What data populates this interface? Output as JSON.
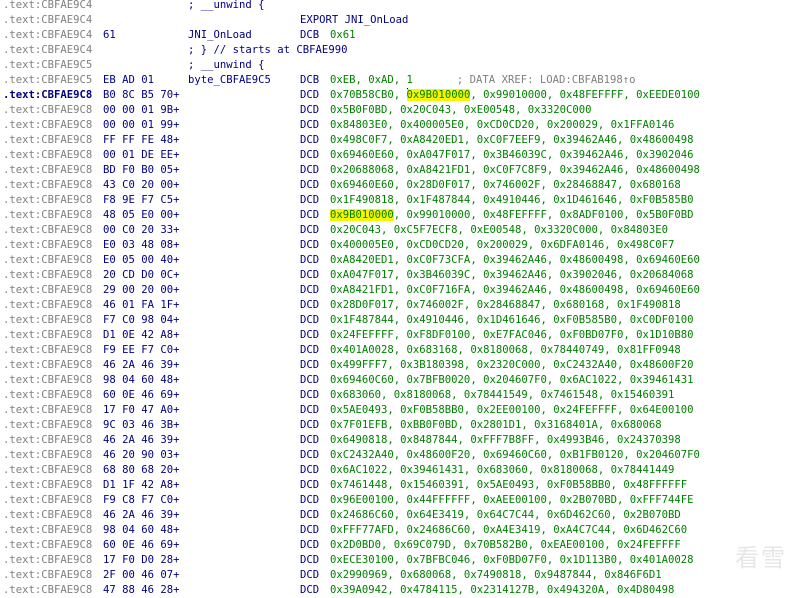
{
  "header_lines": [
    {
      "addr": ".text:CBFAE9C4",
      "bytes": "",
      "text": "; __unwind {"
    },
    {
      "addr": ".text:CBFAE9C4",
      "bytes": "",
      "export": "EXPORT JNI_OnLoad"
    },
    {
      "addr": ".text:CBFAE9C4",
      "bytes": "61",
      "label": "JNI_OnLoad",
      "mnem": "DCB",
      "ops": "0x61"
    },
    {
      "addr": ".text:CBFAE9C4",
      "bytes": "",
      "text": "; } // starts at CBFAE990"
    },
    {
      "addr": ".text:CBFAE9C5",
      "bytes": "",
      "text": "; __unwind {"
    }
  ],
  "byte_line": {
    "addr": ".text:CBFAE9C5",
    "bytes": "EB AD 01",
    "label": "byte_CBFAE9C5",
    "mnem": "DCB",
    "ops": "0xEB, 0xAD, 1",
    "xref": "; DATA XREF: LOAD:CBFAB198",
    "xref_icon": "↑o"
  },
  "cursor_line": {
    "addr": ".text:CBFAE9C8",
    "bytes": "B0 8C B5 70+",
    "mnem": "DCD",
    "ops_pre": "0x70B58CB0, ",
    "ops_hl": "0x9B010000",
    "ops_post": ", 0x99010000, 0x48FEFFFF, 0xEEDE0100"
  },
  "data_lines": [
    {
      "addr": ".text:CBFAE9C8",
      "bytes": "00 00 01 9B+",
      "mnem": "DCD",
      "ops": "0x5B0F0BD, 0x20C043, 0xE00548, 0x3320C000"
    },
    {
      "addr": ".text:CBFAE9C8",
      "bytes": "00 00 01 99+",
      "mnem": "DCD",
      "ops": "0x84803E0, 0x400005E0, 0xCD0CD20, 0x200029, 0x1FFA0146"
    },
    {
      "addr": ".text:CBFAE9C8",
      "bytes": "FF FF FE 48+",
      "mnem": "DCD",
      "ops": "0x498C0F7, 0xA8420ED1, 0xC0F7EEF9, 0x39462A46, 0x48600498"
    },
    {
      "addr": ".text:CBFAE9C8",
      "bytes": "00 01 DE EE+",
      "mnem": "DCD",
      "ops": "0x69460E60, 0xA047F017, 0x3B46039C, 0x39462A46, 0x3902046"
    },
    {
      "addr": ".text:CBFAE9C8",
      "bytes": "BD F0 B0 05+",
      "mnem": "DCD",
      "ops": "0x20688068, 0xA8421FD1, 0xC0F7C8F9, 0x39462A46, 0x48600498"
    },
    {
      "addr": ".text:CBFAE9C8",
      "bytes": "43 C0 20 00+",
      "mnem": "DCD",
      "ops": "0x69460E60, 0x28D0F017, 0x746002F, 0x28468847, 0x680168"
    },
    {
      "addr": ".text:CBFAE9C8",
      "bytes": "F8 9E F7 C5+",
      "mnem": "DCD",
      "ops": "0x1F490818, 0x1F487844, 0x4910446, 0x1D461646, 0xF0B585B0"
    }
  ],
  "hl_line": {
    "addr": ".text:CBFAE9C8",
    "bytes": "48 05 E0 00+",
    "mnem": "DCD",
    "ops_hl": "0x9B010000",
    "ops_post": ", 0x99010000, 0x48FEFFFF, 0x8ADF0100, 0x5B0F0BD"
  },
  "data_lines2": [
    {
      "addr": ".text:CBFAE9C8",
      "bytes": "00 C0 20 33+",
      "mnem": "DCD",
      "ops": "0x20C043, 0xC5F7ECF8, 0xE00548, 0x3320C000, 0x84803E0"
    },
    {
      "addr": ".text:CBFAE9C8",
      "bytes": "E0 03 48 08+",
      "mnem": "DCD",
      "ops": "0x400005E0, 0xCD0CD20, 0x200029, 0x6DFA0146, 0x498C0F7"
    },
    {
      "addr": ".text:CBFAE9C8",
      "bytes": "E0 05 00 40+",
      "mnem": "DCD",
      "ops": "0xA8420ED1, 0xC0F73CFA, 0x39462A46, 0x48600498, 0x69460E60"
    },
    {
      "addr": ".text:CBFAE9C8",
      "bytes": "20 CD D0 0C+",
      "mnem": "DCD",
      "ops": "0xA047F017, 0x3B46039C, 0x39462A46, 0x3902046, 0x20684068"
    },
    {
      "addr": ".text:CBFAE9C8",
      "bytes": "29 00 20 00+",
      "mnem": "DCD",
      "ops": "0xA8421FD1, 0xC0F716FA, 0x39462A46, 0x48600498, 0x69460E60"
    },
    {
      "addr": ".text:CBFAE9C8",
      "bytes": "46 01 FA 1F+",
      "mnem": "DCD",
      "ops": "0x28D0F017, 0x746002F, 0x28468847, 0x680168, 0x1F490818"
    },
    {
      "addr": ".text:CBFAE9C8",
      "bytes": "F7 C0 98 04+",
      "mnem": "DCD",
      "ops": "0x1F487844, 0x4910446, 0x1D461646, 0xF0B585B0, 0xC0DF0100"
    },
    {
      "addr": ".text:CBFAE9C8",
      "bytes": "D1 0E 42 A8+",
      "mnem": "DCD",
      "ops": "0x24FEFFFF, 0xF8DF0100, 0xE7FAC046, 0xF0BD07F0, 0x1D10B80"
    },
    {
      "addr": ".text:CBFAE9C8",
      "bytes": "F9 EE F7 C0+",
      "mnem": "DCD",
      "ops": "0x401A0028, 0x683168, 0x8180068, 0x78440749, 0x81FF0948"
    },
    {
      "addr": ".text:CBFAE9C8",
      "bytes": "46 2A 46 39+",
      "mnem": "DCD",
      "ops": "0x499FFF7, 0x3B180398, 0x2320C000, 0xC2432A40, 0x48600F20"
    },
    {
      "addr": ".text:CBFAE9C8",
      "bytes": "98 04 60 48+",
      "mnem": "DCD",
      "ops": "0x69460C60, 0x7BFB0020, 0x204607F0, 0x6AC1022, 0x39461431"
    },
    {
      "addr": ".text:CBFAE9C8",
      "bytes": "60 0E 46 69+",
      "mnem": "DCD",
      "ops": "0x683060, 0x8180068, 0x78441549, 0x7461548, 0x15460391"
    },
    {
      "addr": ".text:CBFAE9C8",
      "bytes": "17 F0 47 A0+",
      "mnem": "DCD",
      "ops": "0x5AE0493, 0xF0B58BB0, 0x2EE00100, 0x24FEFFFF, 0x64E00100"
    },
    {
      "addr": ".text:CBFAE9C8",
      "bytes": "9C 03 46 3B+",
      "mnem": "DCD",
      "ops": "0x7F01EFB, 0xBB0F0BD, 0x2801D1, 0x3168401A, 0x680068"
    },
    {
      "addr": ".text:CBFAE9C8",
      "bytes": "46 2A 46 39+",
      "mnem": "DCD",
      "ops": "0x6490818, 0x8487844, 0xFFF7B8FF, 0x4993B46, 0x24370398"
    },
    {
      "addr": ".text:CBFAE9C8",
      "bytes": "46 20 90 03+",
      "mnem": "DCD",
      "ops": "0xC2432A40, 0x48600F20, 0x69460C60, 0xB1FB0120, 0x204607F0"
    },
    {
      "addr": ".text:CBFAE9C8",
      "bytes": "68 80 68 20+",
      "mnem": "DCD",
      "ops": "0x6AC1022, 0x39461431, 0x683060, 0x8180068, 0x78441449"
    },
    {
      "addr": ".text:CBFAE9C8",
      "bytes": "D1 1F 42 A8+",
      "mnem": "DCD",
      "ops": "0x7461448, 0x15460391, 0x5AE0493, 0xF0B58BB0, 0x48FFFFFF"
    },
    {
      "addr": ".text:CBFAE9C8",
      "bytes": "F9 C8 F7 C0+",
      "mnem": "DCD",
      "ops": "0x96E00100, 0x44FFFFFF, 0xAEE00100, 0x2B070BD, 0xFFF744FE"
    },
    {
      "addr": ".text:CBFAE9C8",
      "bytes": "46 2A 46 39+",
      "mnem": "DCD",
      "ops": "0x24686C60, 0x64E3419, 0x64C7C44, 0x6D462C60, 0x2B070BD"
    },
    {
      "addr": ".text:CBFAE9C8",
      "bytes": "98 04 60 48+",
      "mnem": "DCD",
      "ops": "0xFFF77AFD, 0x24686C60, 0xA4E3419, 0xA4C7C44, 0x6D462C60"
    },
    {
      "addr": ".text:CBFAE9C8",
      "bytes": "60 0E 46 69+",
      "mnem": "DCD",
      "ops": "0x2D0BD0, 0x69C079D, 0x70B582B0, 0xEAE00100, 0x24FEFFFF"
    },
    {
      "addr": ".text:CBFAE9C8",
      "bytes": "17 F0 D0 28+",
      "mnem": "DCD",
      "ops": "0xECE30100, 0x7BFBC046, 0xF0BD07F0, 0x1D113B0, 0x401A0028"
    },
    {
      "addr": ".text:CBFAE9C8",
      "bytes": "2F 00 46 07+",
      "mnem": "DCD",
      "ops": "0x2990969, 0x680068, 0x7490818, 0x9487844, 0x846F6D1"
    },
    {
      "addr": ".text:CBFAE9C8",
      "bytes": "47 88 46 28+",
      "mnem": "DCD",
      "ops": "0x39A0942, 0x4784115, 0x2314127B, 0x494320A, 0x4D80498"
    }
  ],
  "watermark": "看雪"
}
